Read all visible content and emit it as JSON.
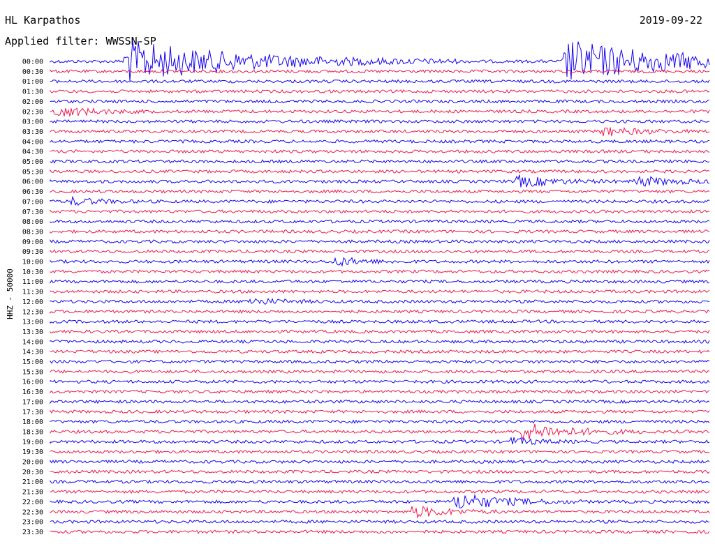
{
  "header": {
    "station": "HL Karpathos",
    "date": "2019-09-22",
    "filter": "Applied filter: WWSSN-SP"
  },
  "colors": {
    "odd": "#1400f0",
    "even": "#f0144c",
    "text": "#000000"
  },
  "chart_data": {
    "type": "line",
    "title": "HL Karpathos",
    "ylabel": "HHZ - 50000",
    "row_labels": [
      "00:00",
      "00:30",
      "01:00",
      "01:30",
      "02:00",
      "02:30",
      "03:00",
      "03:30",
      "04:00",
      "04:30",
      "05:00",
      "05:30",
      "06:00",
      "06:30",
      "07:00",
      "07:30",
      "08:00",
      "08:30",
      "09:00",
      "09:30",
      "10:00",
      "10:30",
      "11:00",
      "11:30",
      "12:00",
      "12:30",
      "13:00",
      "13:30",
      "14:00",
      "14:30",
      "15:00",
      "15:30",
      "16:00",
      "16:30",
      "17:00",
      "17:30",
      "18:00",
      "18:30",
      "19:00",
      "19:30",
      "20:00",
      "20:30",
      "21:00",
      "21:30",
      "22:00",
      "22:30",
      "23:00",
      "23:30"
    ],
    "row_minutes": 30,
    "series_colors": [
      "#1400f0",
      "#f0144c"
    ],
    "events": [
      {
        "row": 0,
        "minute": 3.5,
        "amp": 30,
        "dur": 5
      },
      {
        "row": 0,
        "minute": 23.5,
        "amp": 30,
        "dur": 5
      },
      {
        "row": 5,
        "minute": 0.3,
        "amp": 8,
        "dur": 1.5
      },
      {
        "row": 7,
        "minute": 25.2,
        "amp": 6,
        "dur": 1.5
      },
      {
        "row": 12,
        "minute": 21.3,
        "amp": 8,
        "dur": 1.5
      },
      {
        "row": 12,
        "minute": 26.7,
        "amp": 7,
        "dur": 1.5
      },
      {
        "row": 14,
        "minute": 1.0,
        "amp": 5,
        "dur": 1.2
      },
      {
        "row": 20,
        "minute": 13.0,
        "amp": 6,
        "dur": 1.2
      },
      {
        "row": 24,
        "minute": 9.0,
        "amp": 5,
        "dur": 1.2
      },
      {
        "row": 37,
        "minute": 21.5,
        "amp": 12,
        "dur": 2
      },
      {
        "row": 38,
        "minute": 21.0,
        "amp": 5,
        "dur": 1.2
      },
      {
        "row": 44,
        "minute": 18.5,
        "amp": 12,
        "dur": 2
      },
      {
        "row": 45,
        "minute": 16.5,
        "amp": 8,
        "dur": 1.5
      }
    ]
  }
}
